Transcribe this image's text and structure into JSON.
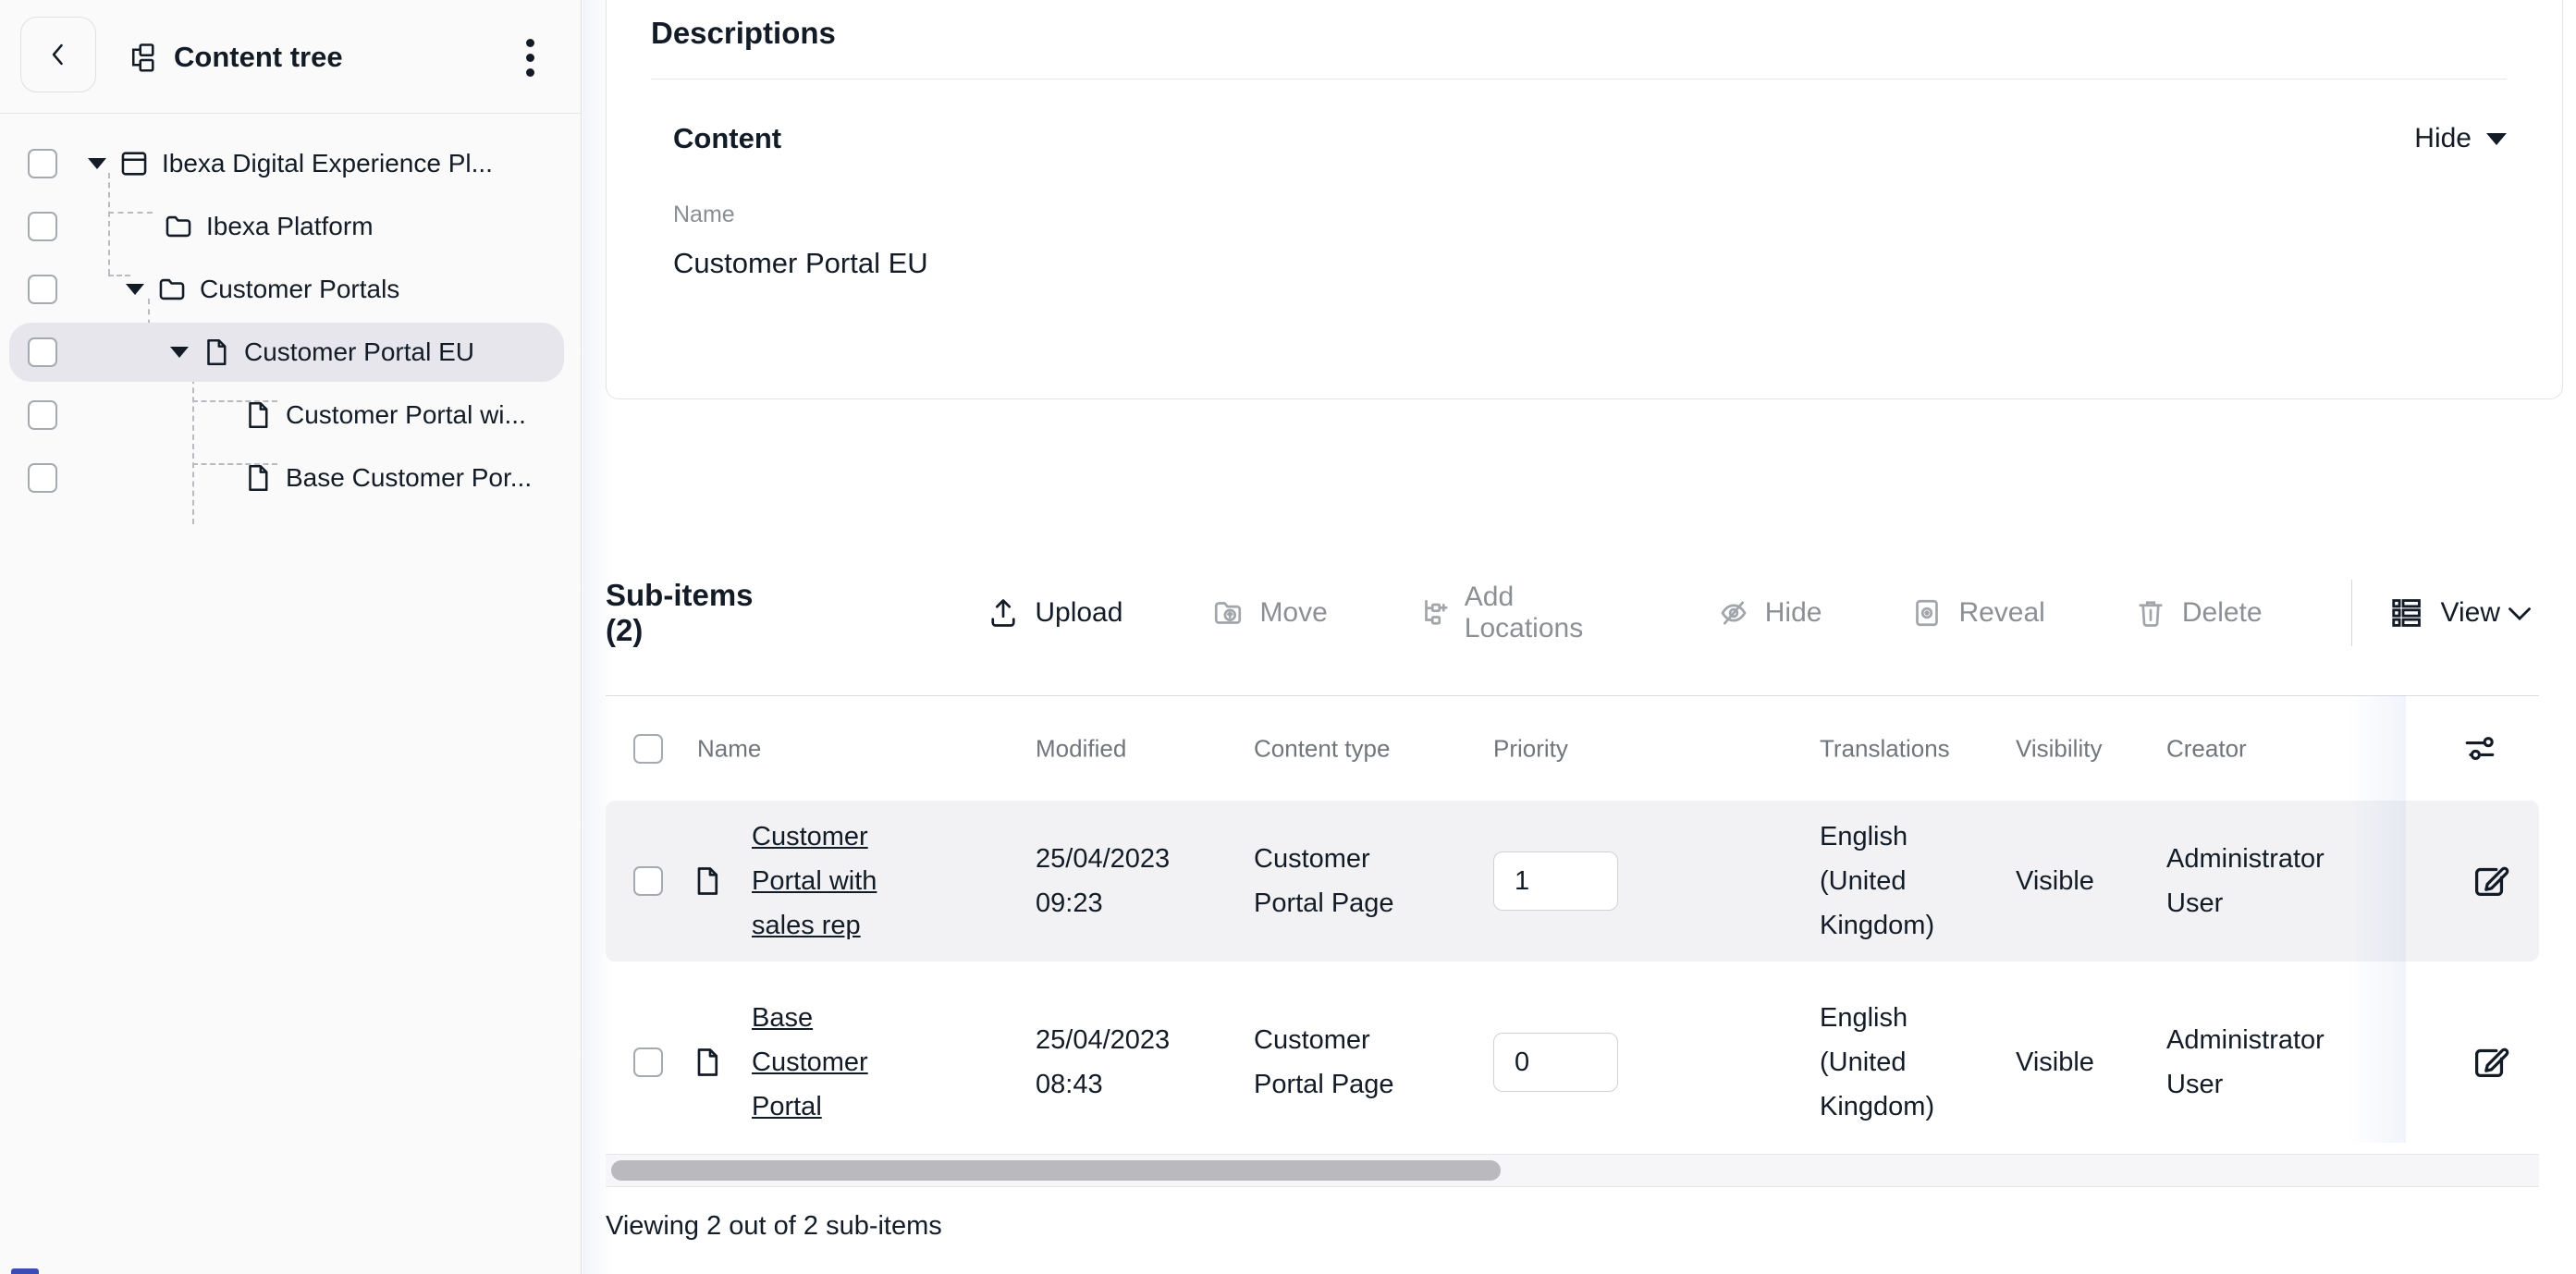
{
  "sidebar": {
    "title": "Content tree",
    "tree": [
      {
        "label": "Ibexa Digital Experience Pl..."
      },
      {
        "label": "Ibexa Platform"
      },
      {
        "label": "Customer Portals"
      },
      {
        "label": "Customer Portal EU"
      },
      {
        "label": "Customer Portal wi..."
      },
      {
        "label": "Base Customer Por..."
      }
    ]
  },
  "content": {
    "section_title": "Descriptions",
    "card_title": "Content",
    "collapse_label": "Hide",
    "field": {
      "label": "Name",
      "value": "Customer Portal EU"
    }
  },
  "subitems": {
    "title": "Sub-items (2)",
    "toolbar": {
      "upload": "Upload",
      "move": "Move",
      "add_locations": "Add Locations",
      "hide": "Hide",
      "reveal": "Reveal",
      "delete": "Delete",
      "view": "View"
    },
    "columns": {
      "name": "Name",
      "modified": "Modified",
      "content_type": "Content type",
      "priority": "Priority",
      "translations": "Translations",
      "visibility": "Visibility",
      "creator": "Creator"
    },
    "rows": [
      {
        "name": "Customer Portal with sales rep",
        "modified": "25/04/2023 09:23",
        "content_type": "Customer Portal Page",
        "priority": "1",
        "translations": "English (United Kingdom)",
        "visibility": "Visible",
        "creator": "Administrator User"
      },
      {
        "name": "Base Customer Portal",
        "modified": "25/04/2023 08:43",
        "content_type": "Customer Portal Page",
        "priority": "0",
        "translations": "English (United Kingdom)",
        "visibility": "Visible",
        "creator": "Administrator User"
      }
    ],
    "footer": "Viewing 2 out of 2 sub-items"
  },
  "colors": {
    "text_dark": "#131c26",
    "text_gray": "#8a8e94",
    "header_gray": "#71767c",
    "row_stripe": "#f2f2f5",
    "selected_tree_row": "#e6e6ec",
    "sidebar_bg": "#fafafa",
    "border": "#dcdee3",
    "accent_blue": "#3a4db4"
  }
}
